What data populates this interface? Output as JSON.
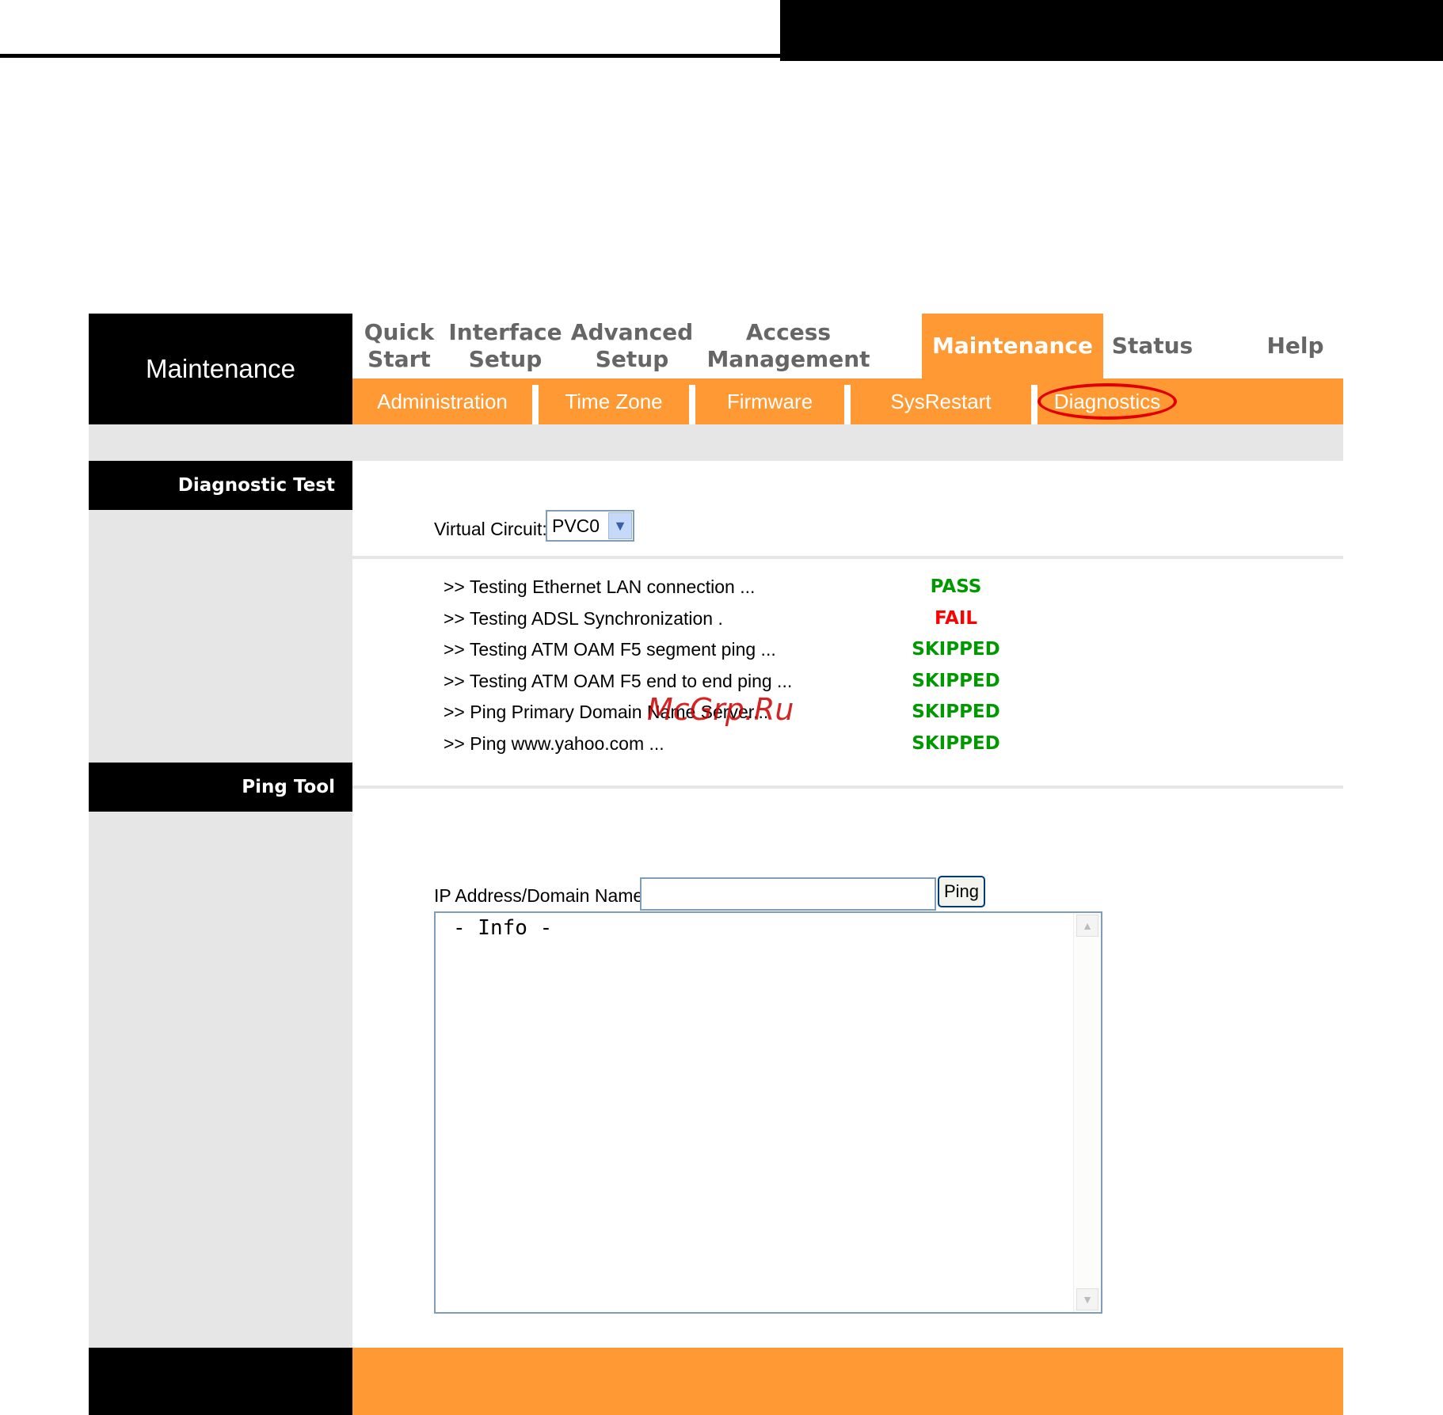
{
  "brand": {
    "title": "Maintenance"
  },
  "tabs": [
    {
      "label": "Quick\nStart"
    },
    {
      "label": "Interface\nSetup"
    },
    {
      "label": "Advanced\nSetup"
    },
    {
      "label": "Access\nManagement"
    },
    {
      "label": "Maintenance"
    },
    {
      "label": "Status"
    },
    {
      "label": "Help"
    }
  ],
  "subnav": [
    {
      "label": "Administration"
    },
    {
      "label": "Time Zone"
    },
    {
      "label": "Firmware"
    },
    {
      "label": "SysRestart"
    },
    {
      "label": "Diagnostics"
    }
  ],
  "diagnostic": {
    "section_title": "Diagnostic Test",
    "vc_label": "Virtual Circuit:",
    "vc_value": "PVC0",
    "tests": [
      {
        "name": ">> Testing Ethernet LAN connection ...",
        "result": "PASS"
      },
      {
        "name": ">> Testing ADSL Synchronization .",
        "result": "FAIL"
      },
      {
        "name": ">> Testing ATM OAM F5 segment ping ...",
        "result": "SKIPPED"
      },
      {
        "name": ">> Testing ATM OAM F5 end to end ping ...",
        "result": "SKIPPED"
      },
      {
        "name": ">> Ping Primary Domain Name Server...",
        "result": "SKIPPED"
      },
      {
        "name": ">> Ping www.yahoo.com ...",
        "result": "SKIPPED"
      }
    ]
  },
  "ping": {
    "section_title": "Ping Tool",
    "ip_label": "IP Address/Domain Name:",
    "ip_value": "",
    "button": "Ping",
    "info_text": "- Info -"
  },
  "watermark": "McGrp.Ru",
  "colors": {
    "accent": "#ff9933",
    "pass": "#009900",
    "fail": "#ff0000"
  }
}
